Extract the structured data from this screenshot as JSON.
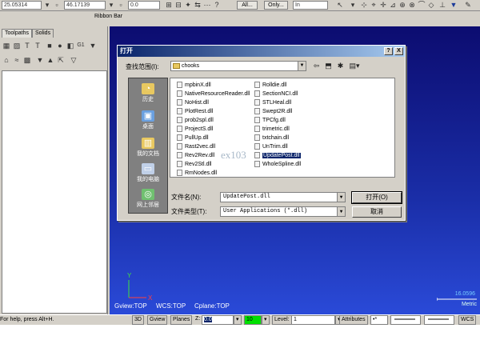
{
  "toolbar": {
    "field1": "25.05314",
    "field2": "46.17139",
    "field3": "0.0",
    "all_button": "All...",
    "only_button": "Only...",
    "mode_value": "In"
  },
  "ribbon_label": "Ribbon Bar",
  "left_panel": {
    "tabs": [
      "Toolpaths",
      "Solids"
    ]
  },
  "viewport": {
    "gview": "Gview:TOP",
    "wcs": "WCS:TOP",
    "cplane": "Cplane:TOP",
    "scale_value": "16.0596",
    "scale_unit": "Metric",
    "axis_y": "Y",
    "axis_x": "X"
  },
  "status_bar": {
    "help": "For help, press Alt+H.",
    "btn_3d": "3D",
    "btn_gview": "Gview",
    "btn_planes": "Planes",
    "z_label": "Z:",
    "z_value": "0.0",
    "color_value": "10",
    "level_label": "Level:",
    "level_value": "1",
    "attributes": "Attributes",
    "wcs": "WCS"
  },
  "dialog": {
    "title": "打开",
    "help_btn": "?",
    "close_btn": "X",
    "look_in_label": "查找范围(I):",
    "look_in_value": "chooks",
    "places": [
      "历史",
      "桌面",
      "我的文档",
      "我的电脑",
      "网上邻居"
    ],
    "files_col1": [
      "mpbinX.dll",
      "NativeResourceReader.dll",
      "NoHist.dll",
      "PlotRest.dll",
      "prob2spl.dll",
      "ProjectS.dll",
      "PullUp.dll",
      "Rast2vec.dll",
      "Rev2Rev.dll",
      "Rev2Stl.dll",
      "RmNodes.dll"
    ],
    "files_col2": [
      "Rolldie.dll",
      "SectionNCI.dll",
      "STLHeal.dll",
      "Swept2R.dll",
      "TPCfg.dll",
      "trimetric.dll",
      "txtchain.dll",
      "UnTrim.dll",
      "UpdatePost.dll",
      "WholeSpline.dll"
    ],
    "selected_file": "UpdatePost.dll",
    "filename_label": "文件名(N):",
    "filename_value": "UpdatePost.dll",
    "filetype_label": "文件类型(T):",
    "filetype_value": "User Applications (*.dll)",
    "open_button": "打开(O)",
    "cancel_button": "取消"
  },
  "watermark": "ex103"
}
